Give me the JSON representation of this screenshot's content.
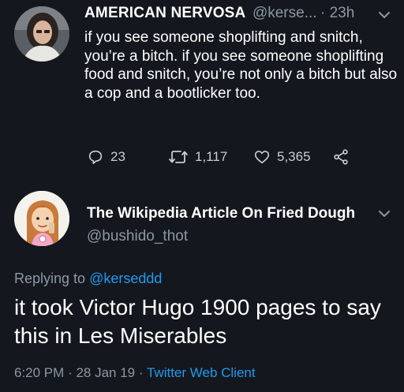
{
  "parent_tweet": {
    "display_name": "AMERICAN NERVOSA",
    "handle": "@kerse...",
    "time": "· 23h",
    "text": "if you see someone shoplifting and snitch, you’re a bitch. if you see someone shoplifting food and snitch, you’re not only a bitch but also a cop and a bootlicker too.",
    "replies": "23",
    "retweets": "1,117",
    "likes": "5,365"
  },
  "reply_tweet": {
    "display_name": "The Wikipedia Article On Fried Dough",
    "handle": "@bushido_thot",
    "replying_prefix": "Replying to",
    "replying_to": "@kerseddd",
    "text": "it took Victor Hugo 1900 pages to say this in Les Miserables",
    "time": "6:20 PM",
    "date": "28 Jan 19",
    "separator": "·",
    "client": "Twitter Web Client"
  },
  "colors": {
    "background": "#14171d",
    "text": "#ffffff",
    "muted": "#8b98a5",
    "link": "#1d9bf0"
  }
}
